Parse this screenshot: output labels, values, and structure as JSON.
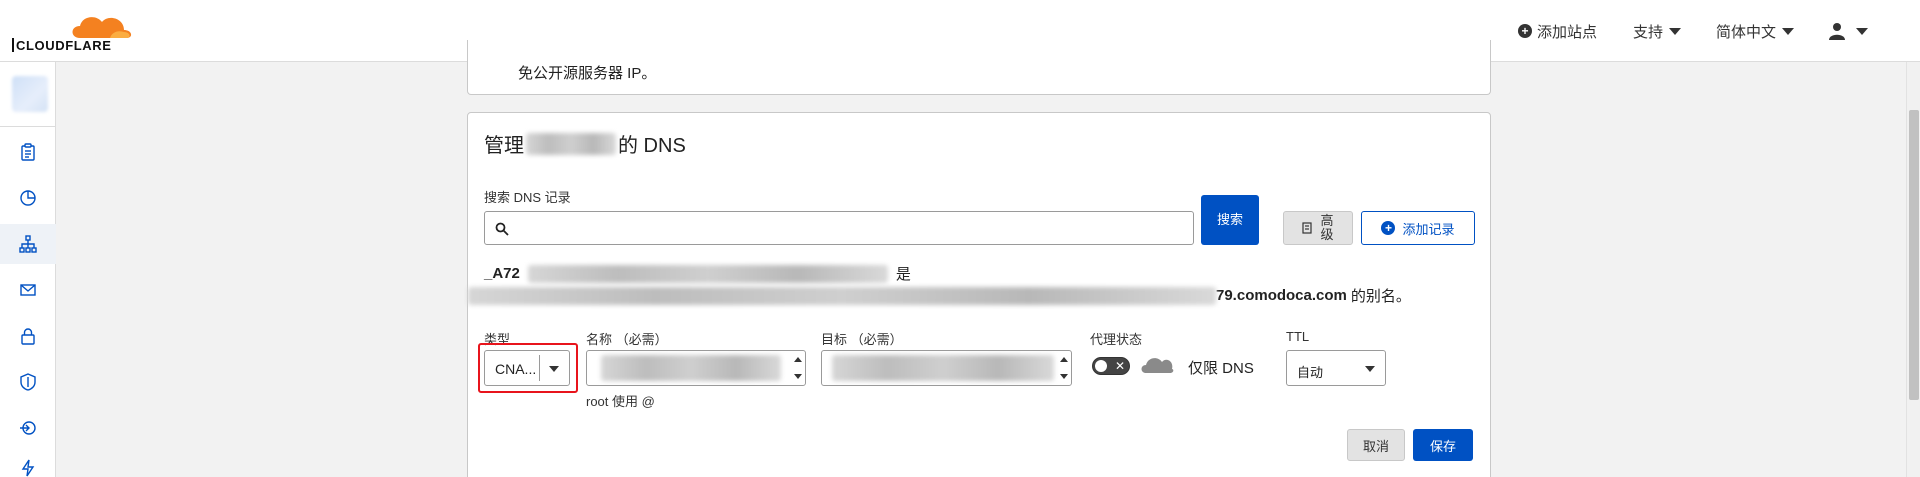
{
  "header": {
    "brand": "CLOUDFLARE",
    "add_site": "添加站点",
    "support": "支持",
    "language": "简体中文",
    "user_icon": "user-icon"
  },
  "sidebar": {
    "items": [
      {
        "icon": "clipboard-icon"
      },
      {
        "icon": "analytics-icon"
      },
      {
        "icon": "dns-icon",
        "active": true
      },
      {
        "icon": "email-icon"
      },
      {
        "icon": "lock-icon"
      },
      {
        "icon": "shield-icon"
      },
      {
        "icon": "traffic-icon"
      },
      {
        "icon": "lightning-icon"
      }
    ]
  },
  "top_card": {
    "text": "免公开源服务器 IP。"
  },
  "dns_card": {
    "title_prefix": "管理",
    "title_suffix": "的 DNS",
    "search_label": "搜索 DNS 记录",
    "search_button": "搜索",
    "advanced_button": "高级",
    "add_record_button": "添加记录",
    "info_line1_prefix": "_A72",
    "info_line1_suffix": "是",
    "info_line2_domain": "79.comodoca.com",
    "info_line2_suffix": "的别名。",
    "labels": {
      "type": "类型",
      "name": "名称 （必需）",
      "target": "目标 （必需）",
      "proxy": "代理状态",
      "ttl": "TTL"
    },
    "type_value": "CNA...",
    "name_hint": "root 使用 @",
    "proxy_status": "仅限 DNS",
    "ttl_value": "自动",
    "cancel_button": "取消",
    "save_button": "保存"
  },
  "colors": {
    "accent": "#0051c3",
    "highlight": "#e8141c",
    "brand_orange": "#f48120"
  }
}
